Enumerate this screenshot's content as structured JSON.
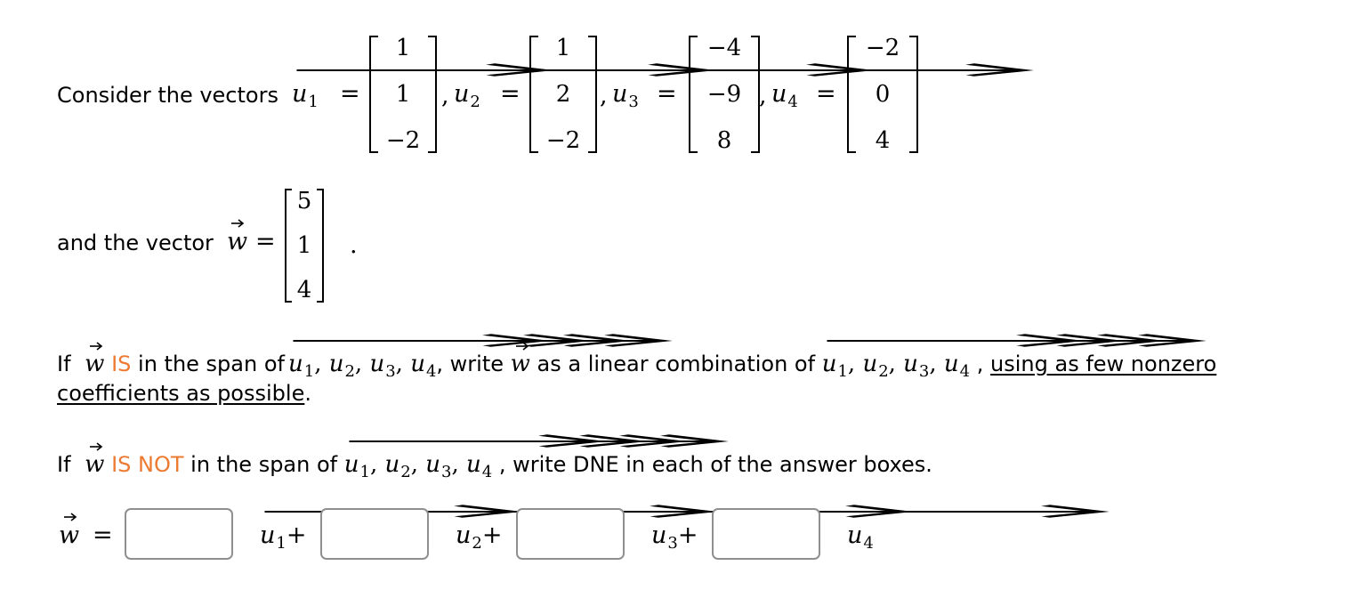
{
  "intro": {
    "consider_text": "Consider the vectors",
    "and_text": "and the vector",
    "period": "."
  },
  "vectors": [
    {
      "name": "u",
      "index": "1",
      "entries": [
        "1",
        "1",
        "−2"
      ]
    },
    {
      "name": "u",
      "index": "2",
      "entries": [
        "1",
        "2",
        "−2"
      ]
    },
    {
      "name": "u",
      "index": "3",
      "entries": [
        "−4",
        "−9",
        "8"
      ]
    },
    {
      "name": "u",
      "index": "4",
      "entries": [
        "−2",
        "0",
        "4"
      ]
    }
  ],
  "w": {
    "name": "w",
    "entries": [
      "5",
      "1",
      "4"
    ]
  },
  "symbols": {
    "equals": "=",
    "comma": ",",
    "plus": "+"
  },
  "instructions": {
    "line1_if": "If",
    "line1_is": "IS",
    "line1_in_span": "in the span of",
    "line1_write": ", write",
    "line1_as_lin_comb": "as a linear combination of",
    "line1_sep": ",",
    "line1_underlined": "using as few nonzero",
    "line2_underlined": "coefficients as possible",
    "line2_period": ".",
    "line3_if": "If",
    "line3_is_not": "IS NOT",
    "line3_in_span": "in the span of",
    "line3_rest": ", write DNE in each of the answer boxes."
  },
  "answer": {
    "boxes": [
      {
        "value": "",
        "placeholder": ""
      },
      {
        "value": "",
        "placeholder": ""
      },
      {
        "value": "",
        "placeholder": ""
      },
      {
        "value": "",
        "placeholder": ""
      }
    ]
  },
  "colors": {
    "highlight": "#ed7a31",
    "box_border": "#8f8f8f"
  }
}
